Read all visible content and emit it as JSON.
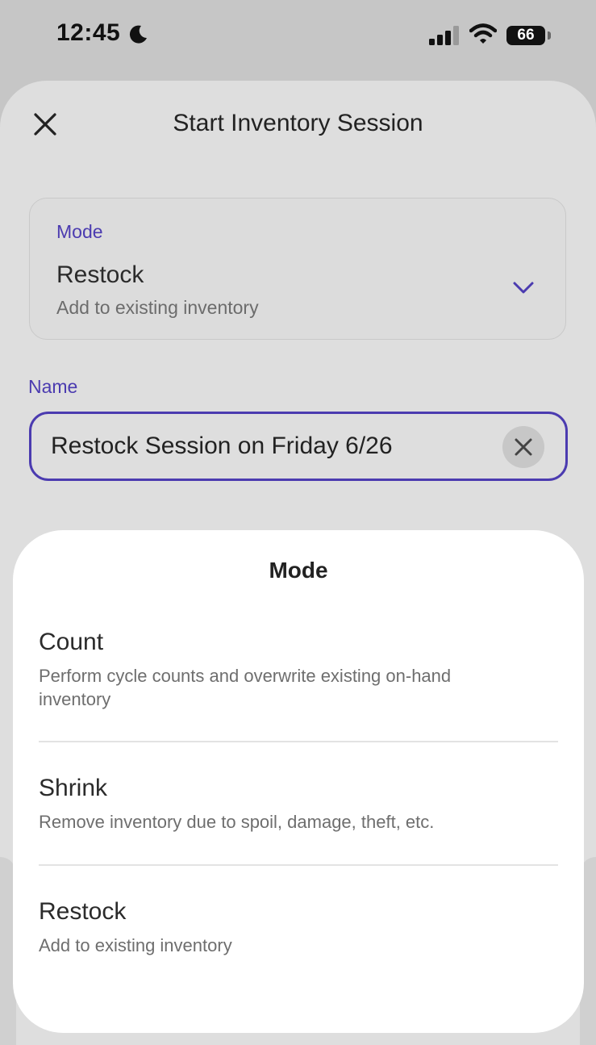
{
  "status_bar": {
    "time": "12:45",
    "battery": "66"
  },
  "header": {
    "title": "Start Inventory Session"
  },
  "mode_field": {
    "label": "Mode",
    "value": "Restock",
    "description": "Add to existing inventory"
  },
  "name_field": {
    "label": "Name",
    "value": "Restock Session on Friday 6/26"
  },
  "mode_picker": {
    "title": "Mode",
    "options": [
      {
        "title": "Count",
        "description": "Perform cycle counts and overwrite existing on-hand inventory"
      },
      {
        "title": "Shrink",
        "description": "Remove inventory due to spoil, damage, theft, etc."
      },
      {
        "title": "Restock",
        "description": "Add to existing inventory"
      }
    ]
  },
  "colors": {
    "accent": "#4b3bb0",
    "sheet": "#dedede",
    "modal": "#ffffff"
  }
}
